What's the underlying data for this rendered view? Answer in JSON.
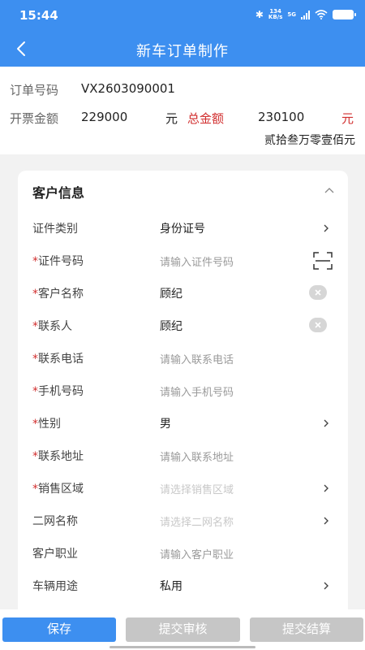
{
  "status_bar": {
    "time": "15:44",
    "net_speed_value": "134",
    "net_speed_unit": "KB/s",
    "net_type": "5G",
    "icons": [
      "bluetooth-icon",
      "signal-icon",
      "wifi-icon",
      "battery-icon"
    ]
  },
  "nav": {
    "title": "新车订单制作",
    "back_icon": "chevron-left-icon"
  },
  "order": {
    "number_label": "订单号码",
    "number_value": "VX2603090001",
    "invoice_label": "开票金额",
    "invoice_value": "229000",
    "invoice_unit": "元",
    "total_label": "总金额",
    "total_value": "230100",
    "total_unit": "元",
    "total_capital": "贰拾叁万零壹佰元"
  },
  "customer": {
    "title": "客户信息",
    "collapse_icon": "chevron-up-icon",
    "fields": [
      {
        "label": "证件类别",
        "required": "",
        "value": "身份证号",
        "placeholder": "",
        "control": "select"
      },
      {
        "label": "证件号码",
        "required": "*",
        "value": "",
        "placeholder": "请输入证件号码",
        "control": "scan"
      },
      {
        "label": "客户名称",
        "required": "*",
        "value": "顾纪",
        "placeholder": "",
        "control": "clear"
      },
      {
        "label": "联系人",
        "required": "*",
        "value": "顾纪",
        "placeholder": "",
        "control": "clear"
      },
      {
        "label": "联系电话",
        "required": "*",
        "value": "",
        "placeholder": "请输入联系电话",
        "control": "none"
      },
      {
        "label": "手机号码",
        "required": "*",
        "value": "",
        "placeholder": "请输入手机号码",
        "control": "none"
      },
      {
        "label": "性别",
        "required": "*",
        "value": "男",
        "placeholder": "",
        "control": "select"
      },
      {
        "label": "联系地址",
        "required": "*",
        "value": "",
        "placeholder": "请输入联系地址",
        "control": "none"
      },
      {
        "label": "销售区域",
        "required": "*",
        "value": "",
        "placeholder": "请选择销售区域",
        "control": "select"
      },
      {
        "label": "二网名称",
        "required": "",
        "value": "",
        "placeholder": "请选择二网名称",
        "control": "select"
      },
      {
        "label": "客户职业",
        "required": "",
        "value": "",
        "placeholder": "请输入客户职业",
        "control": "none"
      },
      {
        "label": "车辆用途",
        "required": "",
        "value": "私用",
        "placeholder": "",
        "control": "select"
      }
    ]
  },
  "actions": {
    "save": "保存",
    "submit_review": "提交审核",
    "submit_settle": "提交结算"
  },
  "colors": {
    "brand": "#3d8ff0",
    "required": "#d12e2e",
    "disabled": "#c6c6c6"
  }
}
